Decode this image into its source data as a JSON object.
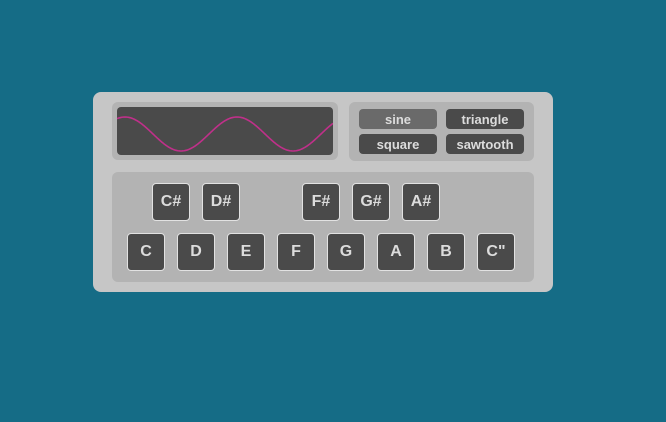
{
  "colors": {
    "background": "#156c86",
    "panel": "#c6c6c6",
    "inset": "#b3b3b3",
    "button": "#4a4a4a",
    "button_active": "#6a6a6a",
    "wave": "#c0308a"
  },
  "oscilloscope": {
    "waveform": "sine"
  },
  "waveforms": {
    "sine": "sine",
    "triangle": "triangle",
    "square": "square",
    "sawtooth": "sawtooth",
    "selected": "sine"
  },
  "keys": {
    "sharps": [
      "C#",
      "D#",
      "F#",
      "G#",
      "A#"
    ],
    "naturals": [
      "C",
      "D",
      "E",
      "F",
      "G",
      "A",
      "B",
      "C\""
    ]
  }
}
